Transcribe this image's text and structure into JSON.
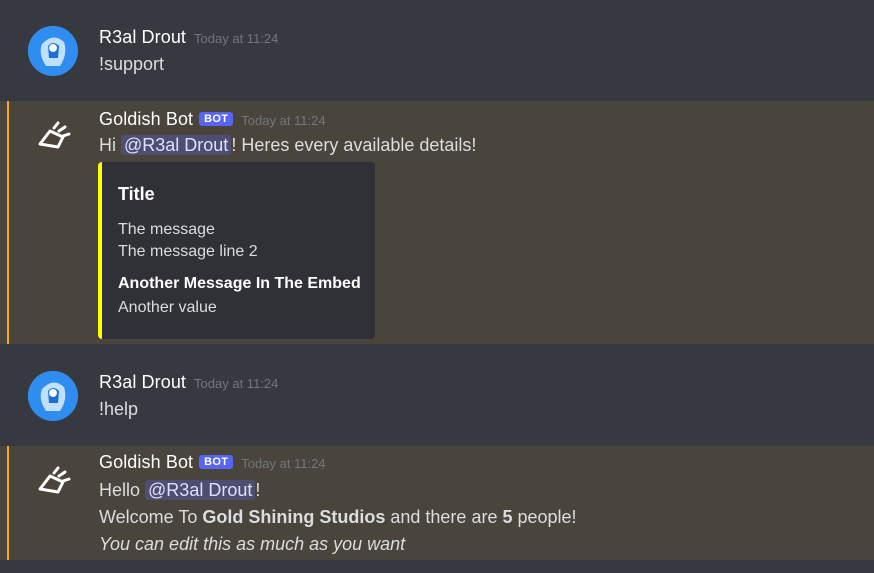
{
  "messages": [
    {
      "author": "R3al Drout",
      "timestamp": "Today at 11:24",
      "content": "!support"
    },
    {
      "author": "Goldish Bot",
      "badge": "BOT",
      "timestamp": "Today at 11:24",
      "content_prefix": "Hi ",
      "mention": "@R3al Drout",
      "content_suffix": "! Heres every available details!",
      "embed": {
        "accent_color": "#ffff00",
        "title": "Title",
        "description_line1": "The message",
        "description_line2": "The message line 2",
        "field_name": "Another Message In The Embed",
        "field_value": "Another value"
      }
    },
    {
      "author": "R3al Drout",
      "timestamp": "Today at 11:24",
      "content": "!help"
    },
    {
      "author": "Goldish Bot",
      "badge": "BOT",
      "timestamp": "Today at 11:24",
      "line1_prefix": "Hello ",
      "mention": "@R3al Drout",
      "line1_suffix": "!",
      "line2_part1": "Welcome To ",
      "line2_bold1": "Gold Shining Studios",
      "line2_part2": " and there are ",
      "line2_bold2": "5",
      "line2_part3": " people!",
      "line3_italic": "You can edit this as much as you want"
    }
  ],
  "colors": {
    "background": "#36393f",
    "mention_highlight_bg": "#49443c",
    "mention_highlight_bar": "#faa81a",
    "bot_badge": "#5865f2",
    "embed_bg": "#2f3136"
  },
  "icons": {
    "user_avatar": "anime-character-avatar",
    "bot_avatar": "goldish-bot-logo-icon"
  }
}
